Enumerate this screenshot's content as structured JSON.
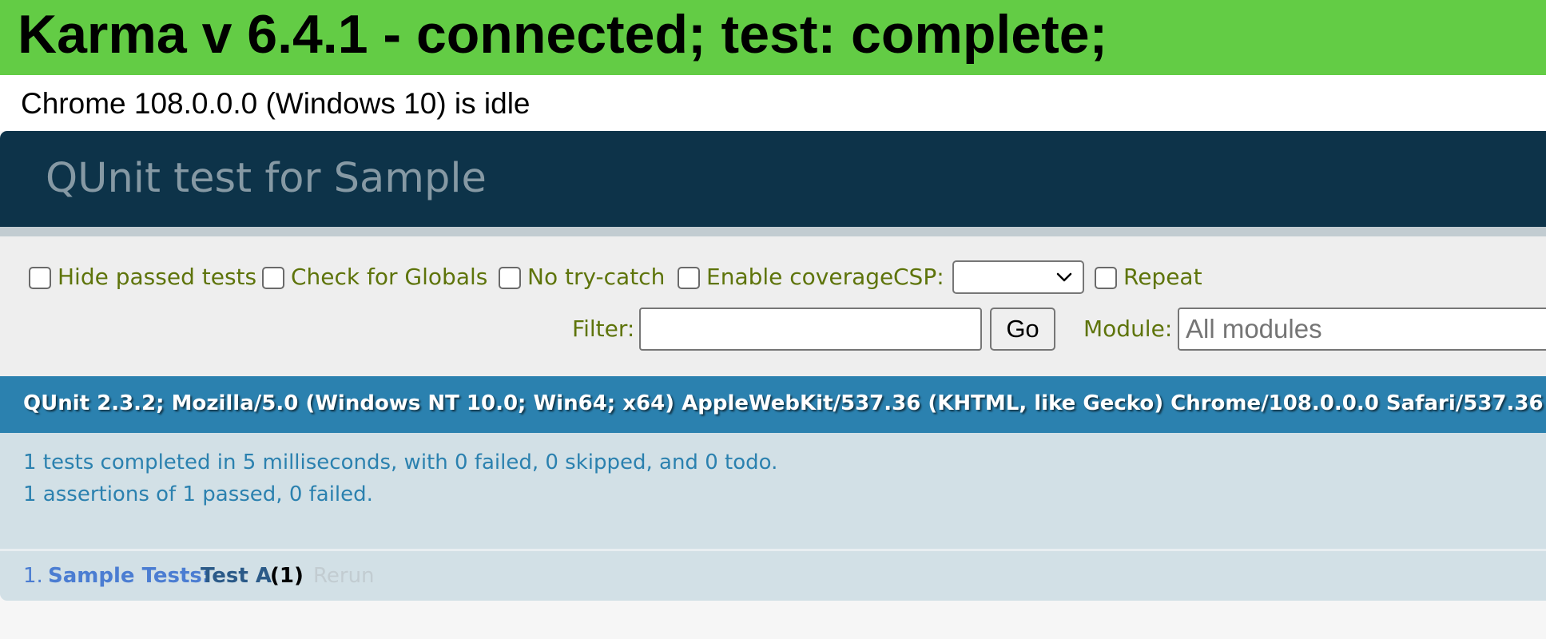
{
  "karma": {
    "title": "Karma v 6.4.1 - connected; test: complete;",
    "browser_status": "Chrome 108.0.0.0 (Windows 10) is idle"
  },
  "qunit": {
    "header": "QUnit test for Sample",
    "toolbar": {
      "hide_passed": "Hide passed tests",
      "check_globals": "Check for Globals",
      "no_try_catch": "No try-catch",
      "enable_coverage": "Enable coverage",
      "csp_label": "CSP:",
      "csp_value": "",
      "repeat": "Repeat",
      "filter_label": "Filter:",
      "filter_value": "",
      "go_label": "Go",
      "module_label": "Module:",
      "module_placeholder": "All modules"
    },
    "user_agent": "QUnit 2.3.2; Mozilla/5.0 (Windows NT 10.0; Win64; x64) AppleWebKit/537.36 (KHTML, like Gecko) Chrome/108.0.0.0 Safari/537.36",
    "result": {
      "line1": "1 tests completed in 5 milliseconds, with 0 failed, 0 skipped, and 0 todo.",
      "line2": "1 assertions of 1 passed, 0 failed."
    },
    "tests": [
      {
        "number": "1.",
        "module": "Sample Tests:",
        "name": "Test A",
        "counts": "(1)",
        "rerun": "Rerun"
      }
    ]
  },
  "colors": {
    "karma_green": "#63cc45",
    "qunit_header": "#0d3349",
    "qunit_user_agent": "#2b81af",
    "qunit_result_bg": "#d2e0e6"
  }
}
